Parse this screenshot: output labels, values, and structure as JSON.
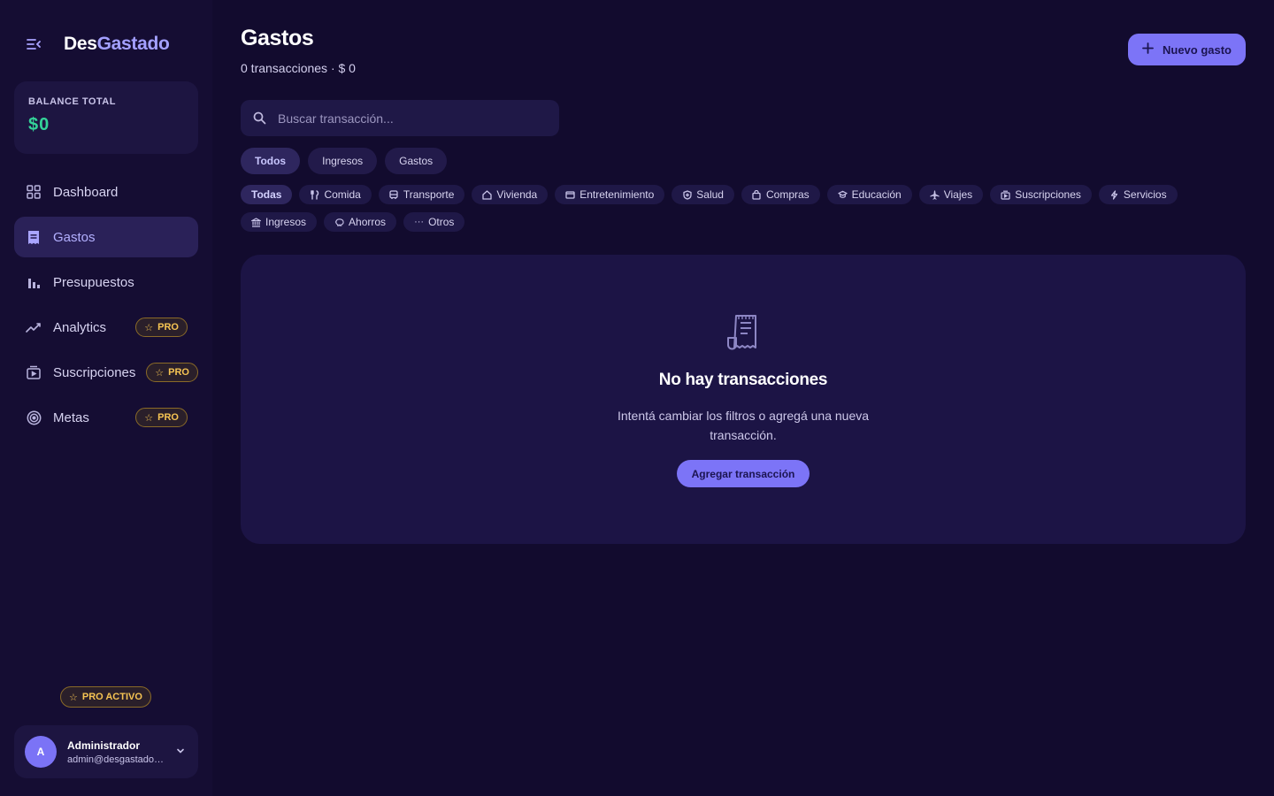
{
  "app": {
    "brand_part1": "Des",
    "brand_part2": "Gastado"
  },
  "sidebar": {
    "balance": {
      "label": "BALANCE TOTAL",
      "value": "$0"
    },
    "items": [
      {
        "label": "Dashboard",
        "icon": "grid-icon",
        "active": false,
        "pro": false
      },
      {
        "label": "Gastos",
        "icon": "receipt-icon",
        "active": true,
        "pro": false
      },
      {
        "label": "Presupuestos",
        "icon": "bar-chart-icon",
        "active": false,
        "pro": false
      },
      {
        "label": "Analytics",
        "icon": "trend-icon",
        "active": false,
        "pro": true
      },
      {
        "label": "Suscripciones",
        "icon": "subscription-icon",
        "active": false,
        "pro": true
      },
      {
        "label": "Metas",
        "icon": "target-icon",
        "active": false,
        "pro": true
      }
    ],
    "pro_badge": "PRO",
    "pro_active": "PRO ACTIVO",
    "user": {
      "initial": "A",
      "name": "Administrador",
      "email": "admin@desgastado.com"
    }
  },
  "main": {
    "title": "Gastos",
    "subtitle": "0 transacciones · $ 0",
    "new_button": "Nuevo gasto",
    "search": {
      "placeholder": "Buscar transacción..."
    },
    "type_tabs": [
      "Todos",
      "Ingresos",
      "Gastos"
    ],
    "categories": [
      {
        "label": "Todas",
        "icon": ""
      },
      {
        "label": "Comida",
        "icon": "utensils-icon"
      },
      {
        "label": "Transporte",
        "icon": "bus-icon"
      },
      {
        "label": "Vivienda",
        "icon": "home-icon"
      },
      {
        "label": "Entretenimiento",
        "icon": "tv-icon"
      },
      {
        "label": "Salud",
        "icon": "shield-icon"
      },
      {
        "label": "Compras",
        "icon": "bag-icon"
      },
      {
        "label": "Educación",
        "icon": "cap-icon"
      },
      {
        "label": "Viajes",
        "icon": "plane-icon"
      },
      {
        "label": "Suscripciones",
        "icon": "subscription-icon"
      },
      {
        "label": "Servicios",
        "icon": "bolt-icon"
      },
      {
        "label": "Ingresos",
        "icon": "bank-icon"
      },
      {
        "label": "Ahorros",
        "icon": "piggy-icon"
      },
      {
        "label": "Otros",
        "icon": "dots-icon"
      }
    ],
    "empty": {
      "title": "No hay transacciones",
      "description": "Intentá cambiar los filtros o agregá una nueva transacción.",
      "button": "Agregar transacción"
    }
  },
  "colors": {
    "background": "#120b2e",
    "sidebar": "#150d33",
    "accent": "#7c74f7",
    "balance_green": "#34d399",
    "pro_gold": "#f6c453"
  }
}
